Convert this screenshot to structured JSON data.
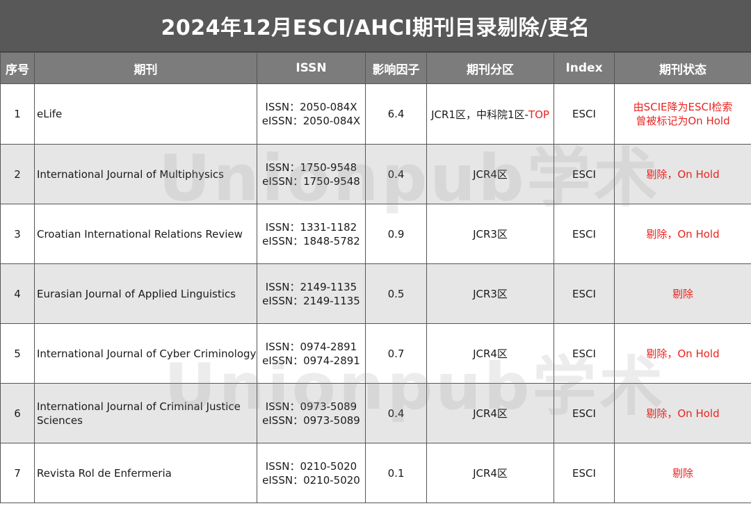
{
  "title": "2024年12月ESCI/AHCI期刊目录剔除/更名",
  "headers": [
    "序号",
    "期刊",
    "ISSN",
    "影响因子",
    "期刊分区",
    "Index",
    "期刊状态"
  ],
  "watermark": "Unionpub学术",
  "colors": {
    "title_bg": "#585858",
    "header_bg": "#7c7c7c",
    "alt_row_bg": "#e6e6e6",
    "status_red": "#e8231e"
  },
  "rows": [
    {
      "no": "1",
      "journal": "eLife",
      "issn": "ISSN：2050-084X",
      "eissn": "eISSN：2050-084X",
      "impact_factor": "6.4",
      "zone_main": "JCR1区，中科院1区-",
      "zone_highlight": "TOP",
      "index": "ESCI",
      "status_lines": [
        "由SCIE降为ESCI检索",
        "曾被标记为On Hold"
      ]
    },
    {
      "no": "2",
      "journal": "International Journal of Multiphysics",
      "issn": "ISSN：1750-9548",
      "eissn": "eISSN：1750-9548",
      "impact_factor": "0.4",
      "zone_main": "JCR4区",
      "zone_highlight": "",
      "index": "ESCI",
      "status_lines": [
        "剔除，On Hold"
      ]
    },
    {
      "no": "3",
      "journal": "Croatian International Relations Review",
      "issn": "ISSN：1331-1182",
      "eissn": "eISSN：1848-5782",
      "impact_factor": "0.9",
      "zone_main": "JCR3区",
      "zone_highlight": "",
      "index": "ESCI",
      "status_lines": [
        "剔除，On Hold"
      ]
    },
    {
      "no": "4",
      "journal": "Eurasian Journal of Applied Linguistics",
      "issn": "ISSN：2149-1135",
      "eissn": "eISSN：2149-1135",
      "impact_factor": "0.5",
      "zone_main": "JCR3区",
      "zone_highlight": "",
      "index": "ESCI",
      "status_lines": [
        "剔除"
      ]
    },
    {
      "no": "5",
      "journal": "International Journal of Cyber Criminology",
      "issn": "ISSN：0974-2891",
      "eissn": "eISSN：0974-2891",
      "impact_factor": "0.7",
      "zone_main": "JCR4区",
      "zone_highlight": "",
      "index": "ESCI",
      "status_lines": [
        "剔除，On Hold"
      ]
    },
    {
      "no": "6",
      "journal": "International Journal of Criminal Justice Sciences",
      "issn": "ISSN：0973-5089",
      "eissn": "eISSN：0973-5089",
      "impact_factor": "0.4",
      "zone_main": "JCR4区",
      "zone_highlight": "",
      "index": "ESCI",
      "status_lines": [
        "剔除，On Hold"
      ]
    },
    {
      "no": "7",
      "journal": "Revista Rol de Enfermeria",
      "issn": "ISSN：0210-5020",
      "eissn": "eISSN：0210-5020",
      "impact_factor": "0.1",
      "zone_main": "JCR4区",
      "zone_highlight": "",
      "index": "ESCI",
      "status_lines": [
        "剔除"
      ]
    }
  ]
}
